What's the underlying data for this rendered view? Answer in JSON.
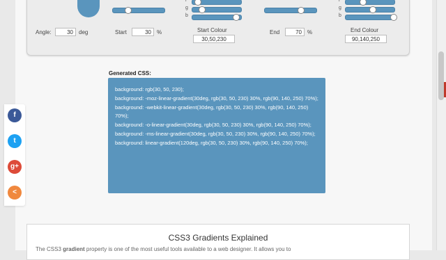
{
  "controls": {
    "angle": {
      "label": "Angle:",
      "value": "30",
      "unit": "deg"
    },
    "start": {
      "label": "Start",
      "value": "30",
      "unit": "%",
      "slider_fraction": 0.3
    },
    "start_colour": {
      "label": "Start Colour",
      "value": "30,50,230",
      "channels": [
        {
          "name": "r",
          "fraction": 0.12
        },
        {
          "name": "g",
          "fraction": 0.2
        },
        {
          "name": "b",
          "fraction": 0.9
        }
      ]
    },
    "end": {
      "label": "End",
      "value": "70",
      "unit": "%",
      "slider_fraction": 0.7
    },
    "end_colour": {
      "label": "End Colour",
      "value": "90,140,250",
      "channels": [
        {
          "name": "r",
          "fraction": 0.35
        },
        {
          "name": "g",
          "fraction": 0.55
        },
        {
          "name": "b",
          "fraction": 0.98
        }
      ]
    }
  },
  "generated_css": {
    "title": "Generated CSS:",
    "lines": [
      "background: rgb(30, 50, 230);",
      "background: -moz-linear-gradient(30deg, rgb(30, 50, 230) 30%, rgb(90, 140, 250) 70%);",
      "background: -webkit-linear-gradient(30deg, rgb(30, 50, 230) 30%, rgb(90, 140, 250) 70%);",
      "background: -o-linear-gradient(30deg, rgb(30, 50, 230) 30%, rgb(90, 140, 250) 70%);",
      "background: -ms-linear-gradient(30deg, rgb(30, 50, 230) 30%, rgb(90, 140, 250) 70%);",
      "background: linear-gradient(120deg, rgb(30, 50, 230) 30%, rgb(90, 140, 250) 70%);"
    ]
  },
  "share": [
    {
      "icon": "facebook-icon",
      "glyph": "f",
      "color": "#3b5998"
    },
    {
      "icon": "twitter-icon",
      "glyph": "t",
      "color": "#1da1f2"
    },
    {
      "icon": "google-plus-icon",
      "glyph": "g+",
      "color": "#dd4b39"
    },
    {
      "icon": "share-icon",
      "glyph": "<",
      "color": "#f0883e"
    }
  ],
  "explained": {
    "title": "CSS3 Gradients Explained",
    "text_pre": "The CSS3 ",
    "text_bold": "gradient",
    "text_post": " property is one of the most useful tools available to a web designer. It allows you to"
  },
  "colors": {
    "accent": "#5a95bd"
  }
}
